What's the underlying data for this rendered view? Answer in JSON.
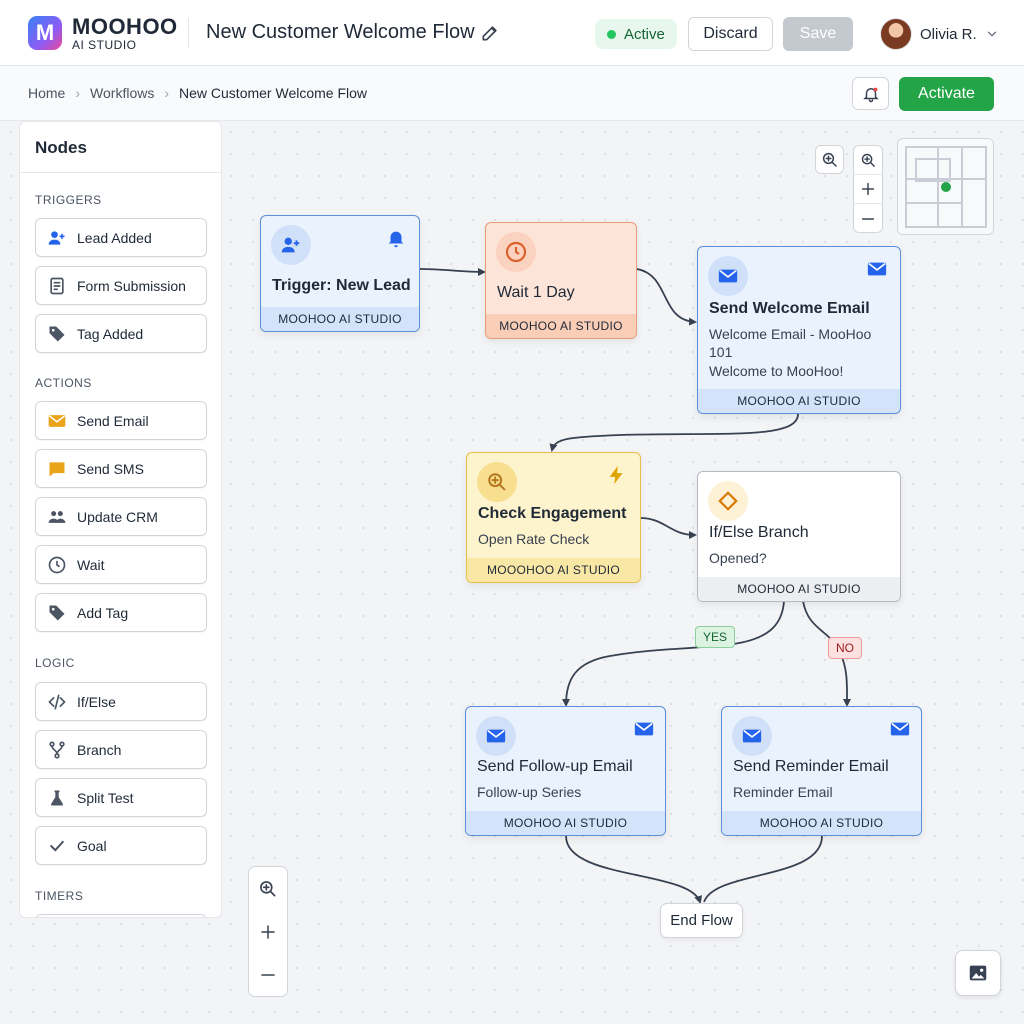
{
  "brand": {
    "name": "MOOHOO",
    "sub": "AI STUDIO",
    "mark": "M"
  },
  "header": {
    "title": "New Customer Welcome Flow",
    "status": "Active",
    "discard_label": "Discard",
    "save_label": "Save",
    "user_name": "Olivia R."
  },
  "breadcrumb": [
    "Home",
    "Workflows",
    "New Customer Welcome Flow"
  ],
  "activate_label": "Activate",
  "sidebar": {
    "title": "Nodes",
    "sections": [
      {
        "label": "TRIGGERS",
        "items": [
          {
            "label": "Lead Added",
            "icon": "user-plus-icon"
          },
          {
            "label": "Form Submission",
            "icon": "form-icon"
          },
          {
            "label": "Tag Added",
            "icon": "tag-icon"
          }
        ]
      },
      {
        "label": "ACTIONS",
        "items": [
          {
            "label": "Send Email",
            "icon": "email-icon"
          },
          {
            "label": "Send SMS",
            "icon": "sms-icon"
          },
          {
            "label": "Update CRM",
            "icon": "users-icon"
          },
          {
            "label": "Wait",
            "icon": "clock-icon"
          },
          {
            "label": "Add Tag",
            "icon": "tag-icon"
          }
        ]
      },
      {
        "label": "LOGIC",
        "items": [
          {
            "label": "If/Else",
            "icon": "code-icon"
          },
          {
            "label": "Branch",
            "icon": "branch-icon"
          },
          {
            "label": "Split Test",
            "icon": "split-test-icon"
          },
          {
            "label": "Goal",
            "icon": "check-icon"
          }
        ]
      },
      {
        "label": "TIMERS",
        "items": []
      }
    ]
  },
  "nodes": {
    "trigger": {
      "title": "Trigger: New Lead",
      "footer": "MOOHOO AI STUDIO"
    },
    "wait": {
      "title": "Wait 1 Day",
      "footer": "MOOHOO AI STUDIO"
    },
    "welcome": {
      "title": "Send Welcome Email",
      "line1": "Welcome Email - MooHoo",
      "line2": "101",
      "line3": "Welcome to MooHoo!",
      "footer": "MOOHOO AI STUDIO"
    },
    "engagement": {
      "title": "Check Engagement",
      "sub": "Open Rate Check",
      "footer": "MOOOHOO AI STUDIO"
    },
    "ifelse": {
      "title": "If/Else Branch",
      "sub": "Opened?",
      "footer": "MOOHOO AI STUDIO"
    },
    "followup": {
      "title": "Send Follow-up Email",
      "sub": "Follow-up Series",
      "footer": "MOOHOO AI STUDIO"
    },
    "reminder": {
      "title": "Send Reminder Email",
      "sub": "Reminder Email",
      "footer": "MOOHOO AI STUDIO"
    },
    "end": {
      "title": "End Flow"
    }
  },
  "branch_labels": {
    "yes": "YES",
    "no": "NO"
  },
  "colors": {
    "primary_green": "#22a447",
    "node_blue": "#5b8fd9",
    "node_orange": "#e79a76",
    "node_yellow": "#e6c04a"
  }
}
